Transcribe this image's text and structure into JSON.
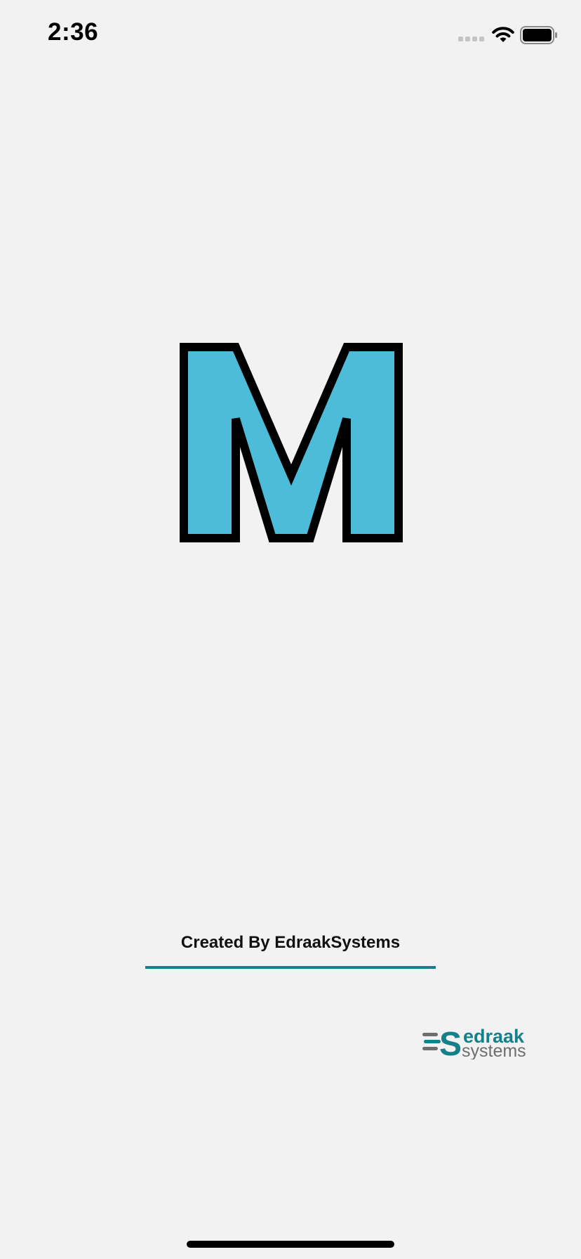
{
  "status_bar": {
    "time": "2:36",
    "signal_icon": "cellular-signal-icon",
    "wifi_icon": "wifi-icon",
    "battery_icon": "battery-icon"
  },
  "splash": {
    "logo_letter": "M",
    "logo_fill_color": "#4dbcd8",
    "logo_outline_color": "#000000"
  },
  "footer": {
    "credit_text": "Created By EdraakSystems",
    "accent_color": "#14808a",
    "brand_logo": {
      "icon": "edraak-systems-logo",
      "line1": "edraak",
      "line2": "systems"
    }
  }
}
